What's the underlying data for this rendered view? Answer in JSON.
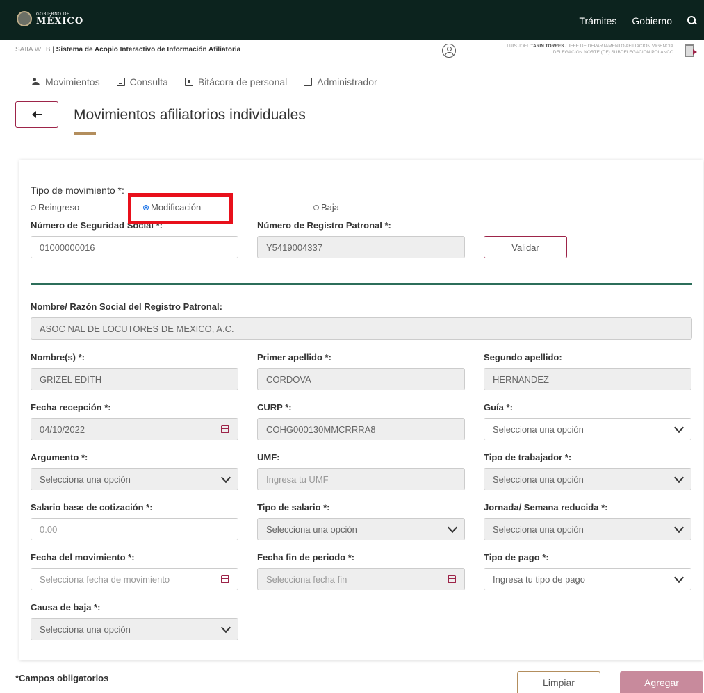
{
  "topbar": {
    "logo_small": "GOBIERNO DE",
    "logo_big": "MÉXICO",
    "nav": [
      "Trámites",
      "Gobierno"
    ]
  },
  "subbar": {
    "app_light": "SAIIA WEB",
    "app_bold": "Sistema de Acopio Interactivo de Información Afiliatoria",
    "user_prefix": "LUIS JOEL",
    "user_name": "TARIN TORRES",
    "user_line1_rest": "/ JEFE DE DEPARTAMENTO AFILIACION VIGENCIA",
    "user_line2": "DELEGACION NORTE (DF) SUBDELEGACION POLANCO"
  },
  "menu": [
    "Movimientos",
    "Consulta",
    "Bitácora de personal",
    "Administrador"
  ],
  "page_title": "Movimientos afiliatorios individuales",
  "form": {
    "tipo_movimiento_label": "Tipo de movimiento *:",
    "radios": [
      "Reingreso",
      "Modificación",
      "Baja"
    ],
    "selected_radio": "Modificación",
    "nss_label": "Número de Seguridad Social *:",
    "nss_value": "01000000016",
    "nrp_label": "Número de Registro Patronal *:",
    "nrp_value": "Y5419004337",
    "validar_label": "Validar",
    "razon_label": "Nombre/ Razón Social del Registro Patronal:",
    "razon_value": "ASOC NAL DE LOCUTORES DE MEXICO, A.C.",
    "nombre_label": "Nombre(s) *:",
    "nombre_value": "GRIZEL EDITH",
    "ap1_label": "Primer apellido *:",
    "ap1_value": "CORDOVA",
    "ap2_label": "Segundo apellido:",
    "ap2_value": "HERNANDEZ",
    "fecha_rec_label": "Fecha recepción *:",
    "fecha_rec_value": "04/10/2022",
    "curp_label": "CURP *:",
    "curp_value": "COHG000130MMCRRRA8",
    "guia_label": "Guía *:",
    "guia_value": "Selecciona una opción",
    "argumento_label": "Argumento *:",
    "argumento_value": "Selecciona una opción",
    "umf_label": "UMF:",
    "umf_placeholder": "Ingresa tu UMF",
    "tipo_trab_label": "Tipo de trabajador *:",
    "tipo_trab_value": "Selecciona una opción",
    "salario_label": "Salario base de cotización *:",
    "salario_placeholder": "0.00",
    "tipo_salario_label": "Tipo de salario *:",
    "tipo_salario_value": "Selecciona una opción",
    "jornada_label": "Jornada/ Semana reducida *:",
    "jornada_value": "Selecciona una opción",
    "fecha_mov_label": "Fecha del movimiento *:",
    "fecha_mov_placeholder": "Selecciona fecha de movimiento",
    "fecha_fin_label": "Fecha fin de periodo *:",
    "fecha_fin_placeholder": "Selecciona fecha fin",
    "tipo_pago_label": "Tipo de pago *:",
    "tipo_pago_value": "Ingresa tu tipo de pago",
    "causa_label": "Causa de baja *:",
    "causa_value": "Selecciona una opción"
  },
  "footer": {
    "required_note": "*Campos obligatorios",
    "clear_label": "Limpiar",
    "add_label": "Agregar"
  },
  "colors": {
    "header_bg": "#0c231e",
    "accent": "#9d2449",
    "gold": "#b38e5d",
    "divider": "#2c6e5a",
    "highlight": "#e8101b"
  }
}
